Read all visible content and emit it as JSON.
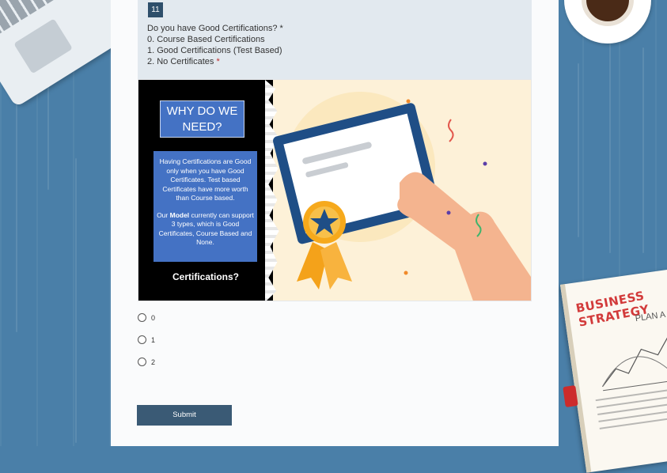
{
  "question": {
    "number": "11",
    "title": "Do you have Good Certifications?",
    "required_mark": "*",
    "lines": [
      "0. Course Based Certifications",
      "1. Good Certifications (Test Based)",
      "2. No Certificates"
    ]
  },
  "illustration": {
    "heading": "WHY DO WE NEED?",
    "body_para1": "Having Certifications are Good only when you have Good Certificates. Test based Certificates have more worth than Course based.",
    "body_para2_prefix": "Our",
    "body_para2_bold": "Model",
    "body_para2_rest": "currently can support 3 types, which is Good Certificates, Course Based and None.",
    "caption": "Certifications?"
  },
  "options": [
    "0",
    "1",
    "2"
  ],
  "submit_label": "Submit",
  "notebook": {
    "title": "BUSINESS STRATEGY",
    "subtitle": "PLAN A"
  },
  "colors": {
    "accent": "#2e4f6b",
    "button": "#3a5a75",
    "required": "#c02a2a",
    "desk": "#4a7fa8"
  }
}
